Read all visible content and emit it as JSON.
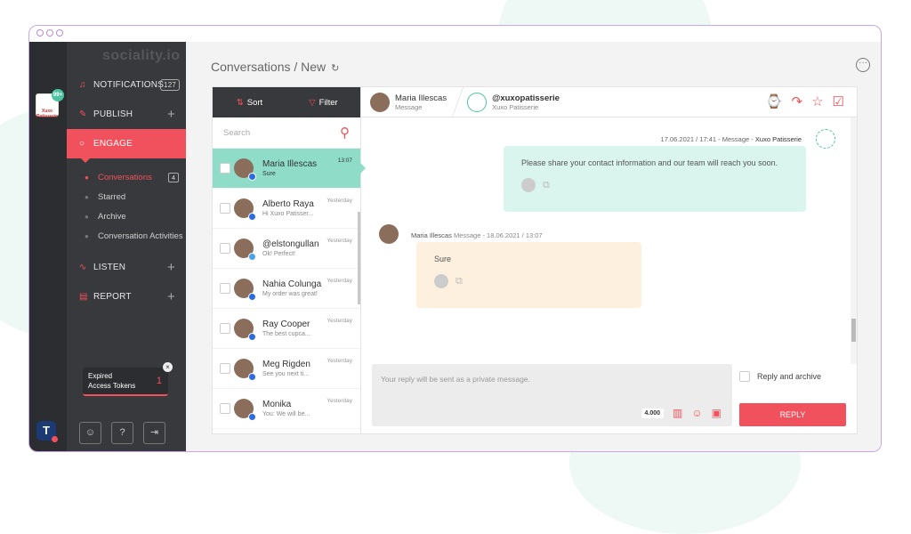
{
  "app": {
    "brand": "sociality.io",
    "account_badge": "99+",
    "account_label": "Xuxo Patisserie"
  },
  "nav": {
    "notifications": {
      "label": "NOTIFICATIONS",
      "count": "127"
    },
    "publish": {
      "label": "PUBLISH"
    },
    "engage": {
      "label": "ENGAGE"
    },
    "listen": {
      "label": "LISTEN"
    },
    "report": {
      "label": "REPORT"
    },
    "subitems": [
      {
        "label": "Conversations",
        "count": "4"
      },
      {
        "label": "Starred"
      },
      {
        "label": "Archive"
      },
      {
        "label": "Conversation Activities"
      }
    ]
  },
  "expired": {
    "line1": "Expired",
    "line2": "Access Tokens",
    "count": "1"
  },
  "page": {
    "title": "Conversations / New"
  },
  "list": {
    "sort": "Sort",
    "filter": "Filter",
    "search_placeholder": "Search",
    "items": [
      {
        "name": "Maria Illescas",
        "preview": "Sure",
        "time": "13:07",
        "network": "facebook"
      },
      {
        "name": "Alberto Raya",
        "preview": "Hi Xuxo Patisser...",
        "time": "Yesterday",
        "network": "facebook"
      },
      {
        "name": "@elstongullan",
        "preview": "Ok! Perfect!",
        "time": "Yesterday",
        "network": "twitter"
      },
      {
        "name": "Nahia Colunga",
        "preview": "My order was great!",
        "time": "Yesterday",
        "network": "facebook"
      },
      {
        "name": "Ray Cooper",
        "preview": "The best cupca...",
        "time": "Yesterday",
        "network": "facebook"
      },
      {
        "name": "Meg Rigden",
        "preview": "See you next ti...",
        "time": "Yesterday",
        "network": "facebook"
      },
      {
        "name": "Monika",
        "preview": "You: We will be...",
        "time": "Yesterday",
        "network": "facebook"
      }
    ]
  },
  "chat": {
    "contact": {
      "name": "Maria Illescas",
      "sub": "Message"
    },
    "page": {
      "handle": "@xuxopatisserie",
      "name": "Xuxo Patisserie"
    },
    "outgoing": {
      "meta": "17.06.2021 / 17:41 - Message -",
      "author": "Xuxo Patisserie",
      "text": "Please share your contact information and our team will reach you soon."
    },
    "incoming": {
      "author": "Maria Illescas",
      "meta": "Message -  18.06.2021 / 13:07",
      "text": "Sure"
    },
    "composer": {
      "placeholder": "Your reply will be sent as a private message.",
      "char_count": "4.000"
    },
    "reply_and_archive": "Reply and archive",
    "reply_button": "REPLY"
  },
  "colors": {
    "accent": "#f0515d",
    "teal": "#8fddc9",
    "sidebar": "#38393c"
  }
}
